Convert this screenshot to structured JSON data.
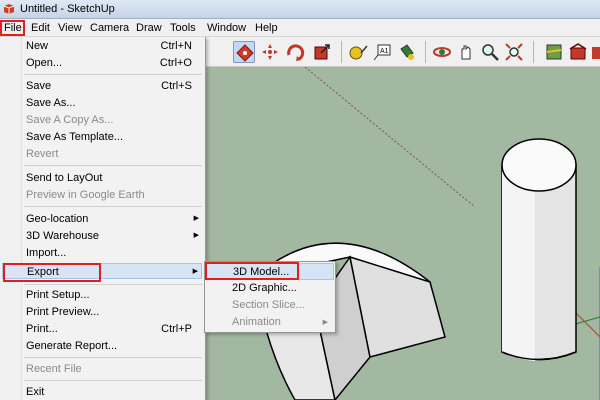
{
  "window": {
    "title": "Untitled - SketchUp",
    "icon": "sketchup-logo-icon"
  },
  "menubar": [
    "File",
    "Edit",
    "View",
    "Camera",
    "Draw",
    "Tools",
    "Window",
    "Help"
  ],
  "file_menu": {
    "new": {
      "label": "New",
      "shortcut": "Ctrl+N"
    },
    "open": {
      "label": "Open...",
      "shortcut": "Ctrl+O"
    },
    "save": {
      "label": "Save",
      "shortcut": "Ctrl+S"
    },
    "save_as": {
      "label": "Save As..."
    },
    "save_copy_as": {
      "label": "Save A Copy As..."
    },
    "save_as_template": {
      "label": "Save As Template..."
    },
    "revert": {
      "label": "Revert"
    },
    "send_to_layout": {
      "label": "Send to LayOut"
    },
    "preview_google_earth": {
      "label": "Preview in Google Earth"
    },
    "geo_location": {
      "label": "Geo-location"
    },
    "warehouse": {
      "label": "3D Warehouse"
    },
    "import": {
      "label": "Import..."
    },
    "export": {
      "label": "Export"
    },
    "print_setup": {
      "label": "Print Setup..."
    },
    "print_preview": {
      "label": "Print Preview..."
    },
    "print": {
      "label": "Print...",
      "shortcut": "Ctrl+P"
    },
    "generate_report": {
      "label": "Generate Report..."
    },
    "recent_file": {
      "label": "Recent File"
    },
    "exit": {
      "label": "Exit"
    }
  },
  "export_submenu": {
    "model_3d": {
      "label": "3D Model..."
    },
    "graphic_2d": {
      "label": "2D Graphic..."
    },
    "section_slice": {
      "label": "Section Slice..."
    },
    "animation": {
      "label": "Animation"
    }
  },
  "toolbar_icons": [
    "move-icon",
    "push-pull-icon",
    "rotate-icon",
    "follow-me-icon",
    "scale-icon",
    "offset-icon",
    "tape-measure-icon",
    "dimension-icon",
    "text-icon",
    "paint-bucket-icon",
    "orbit-icon",
    "pan-icon",
    "zoom-icon",
    "zoom-extents-icon",
    "map-icon",
    "warehouse-icon",
    "components-icon"
  ],
  "colors": {
    "highlight_red": "#e02020",
    "viewport_green": "#a3b8a0",
    "menu_highlight": "#d6e4f5"
  }
}
